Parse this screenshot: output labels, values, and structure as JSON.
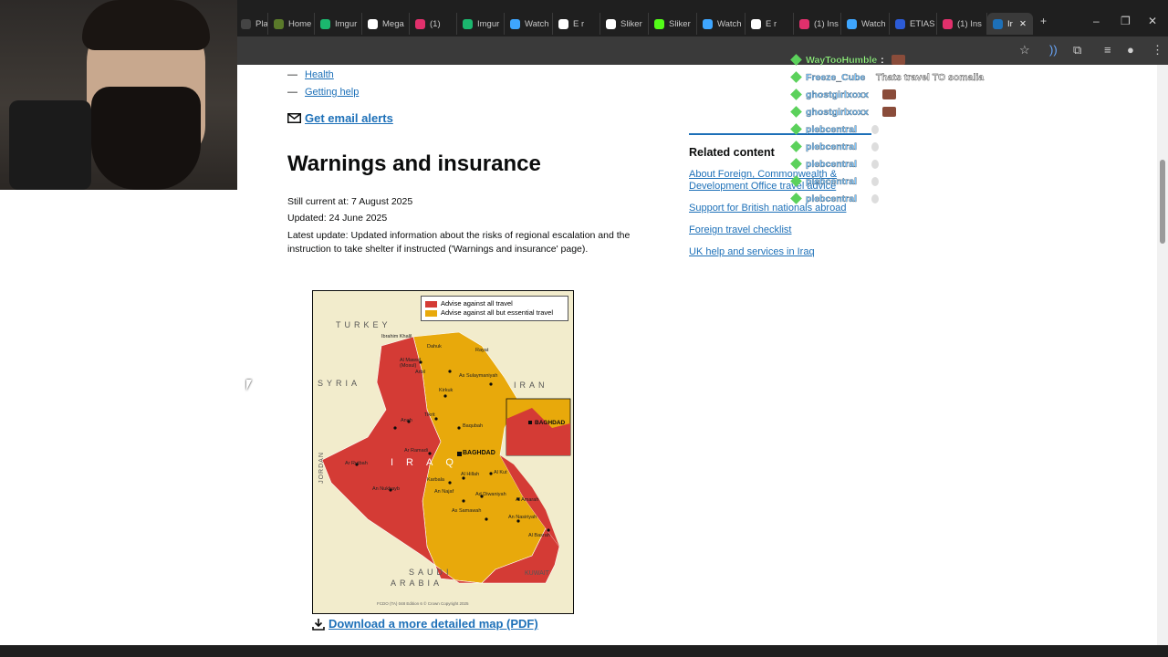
{
  "browser": {
    "tabs": [
      {
        "label": "Playtr",
        "color": "#444444"
      },
      {
        "label": "Home",
        "color": "#5a7a2a"
      },
      {
        "label": "Imgur",
        "color": "#1bb76e"
      },
      {
        "label": "Mega",
        "color": "#ffffff"
      },
      {
        "label": "(1)",
        "color": "#e1306c"
      },
      {
        "label": "Imgur",
        "color": "#1bb76e"
      },
      {
        "label": "Watch",
        "color": "#3ea6ff"
      },
      {
        "label": "E r",
        "color": "#ffffff"
      },
      {
        "label": "Sliker",
        "color": "#ffffff"
      },
      {
        "label": "Sliker",
        "color": "#53fc18"
      },
      {
        "label": "Watch",
        "color": "#3ea6ff"
      },
      {
        "label": "E r",
        "color": "#ffffff"
      },
      {
        "label": "(1) Ins",
        "color": "#e1306c"
      },
      {
        "label": "Watch",
        "color": "#3ea6ff"
      },
      {
        "label": "ETIAS",
        "color": "#2c5bd6"
      },
      {
        "label": "(1) Ins",
        "color": "#e1306c"
      },
      {
        "label": "Ir",
        "color": "#1d70b8"
      }
    ],
    "new_tab": "+",
    "minimize": "–",
    "restore": "❐",
    "close": "✕"
  },
  "page": {
    "nav_links": [
      "Health",
      "Getting help"
    ],
    "dash": "—",
    "email_alerts": "Get email alerts",
    "heading": "Warnings and insurance",
    "still_current_label": "Still current at:",
    "still_current_value": "7 August 2025",
    "updated_label": "Updated:",
    "updated_value": "24 June 2025",
    "latest_update_label": "Latest update:",
    "latest_update_value": "Updated information about the risks of regional escalation and the instruction to take shelter if instructed ('Warnings and insurance' page).",
    "download_map": "Download a more detailed map (PDF)"
  },
  "related": {
    "heading": "Related content",
    "links": [
      "About Foreign, Commonwealth & Development Office travel advice",
      "Support for British nationals abroad",
      "Foreign travel checklist",
      "UK help and services in Iraq"
    ]
  },
  "map": {
    "legend": [
      {
        "label": "Advise against all travel",
        "color": "#d43b35"
      },
      {
        "label": "Advise against all but essential travel",
        "color": "#e8a90b"
      }
    ],
    "country_labels": [
      "TURKEY",
      "SYRIA",
      "IRAN",
      "JORDAN",
      "SAUDI",
      "ARABIA",
      "KUWAIT",
      "IRAQ"
    ],
    "cities": [
      "Ibrahim Khalil",
      "Dahuk",
      "Rayat",
      "Al Mawsil (Mosul)",
      "Arbil",
      "As Sulaymaniyah",
      "Kirkuk",
      "Tikrit",
      "Baqubah",
      "Anah",
      "Ar Ramadi",
      "BAGHDAD",
      "Al Hillah",
      "Karbala",
      "An Najaf",
      "Al Kut",
      "Ad Diwaniyah",
      "Al Amarah",
      "As Samawah",
      "An Nasiriyah",
      "Al Basrah",
      "Ar Rutbah",
      "An Nukhayb"
    ],
    "inset_label": "BAGHDAD",
    "credit": "FCDO (TA) 048 Edition 6 © Crown Copyright 2025"
  },
  "overlay_chat": [
    {
      "user": "WayTooHumble",
      "message": "",
      "user_color": "#9fff7a"
    },
    {
      "user": "Freeze_Cube",
      "message": "Thats travel TO somalia",
      "user_color": "#7ec8ff"
    },
    {
      "user": "ghostgirlxoxx",
      "message": "",
      "user_color": "#7ec8ff"
    },
    {
      "user": "ghostgirlxoxx",
      "message": "",
      "user_color": "#7ec8ff"
    },
    {
      "user": "plebcentral",
      "message": "",
      "user_color": "#7ec8ff"
    },
    {
      "user": "plebcentral",
      "message": "",
      "user_color": "#7ec8ff"
    },
    {
      "user": "plebcentral",
      "message": "",
      "user_color": "#7ec8ff"
    },
    {
      "user": "plebcentral",
      "message": "",
      "user_color": "#7ec8ff"
    },
    {
      "user": "plebcentral",
      "message": "",
      "user_color": "#7ec8ff"
    }
  ],
  "colors": {
    "link": "#1d70b8",
    "text": "#0b0c0c",
    "red_zone": "#d43b35",
    "amber_zone": "#e8a90b"
  }
}
